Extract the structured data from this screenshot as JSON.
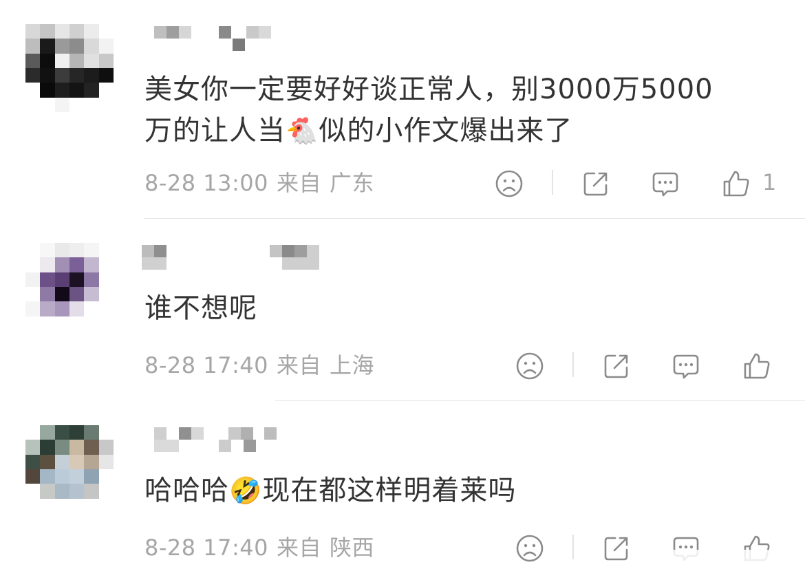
{
  "comments": [
    {
      "content_line1": "美女你一定要好好谈正常人，别3000万5000",
      "content_line2_pre": "万的让人当",
      "content_emoji": "🐔",
      "content_line2_post": "似的小作文爆出来了",
      "date": "8-28 13:00",
      "from_label": "来自",
      "location": "广东",
      "like_count": "1"
    },
    {
      "content": "谁不想呢",
      "date": "8-28 17:40",
      "from_label": "来自",
      "location": "上海",
      "like_count": ""
    },
    {
      "content_pre": "哈哈哈",
      "content_emoji": "🤣",
      "content_post": "现在都这样明着莱吗",
      "date": "8-28 17:40",
      "from_label": "来自",
      "location": "陕西",
      "like_count": ""
    }
  ],
  "icons": {
    "dislike": "sad-face-icon",
    "share": "share-icon",
    "reply": "comment-bubble-icon",
    "like": "thumbs-up-icon"
  },
  "colors": {
    "text": "#333333",
    "meta": "#a6a6a6",
    "icon": "#8a8a8a",
    "divider": "#e6e6e6"
  }
}
